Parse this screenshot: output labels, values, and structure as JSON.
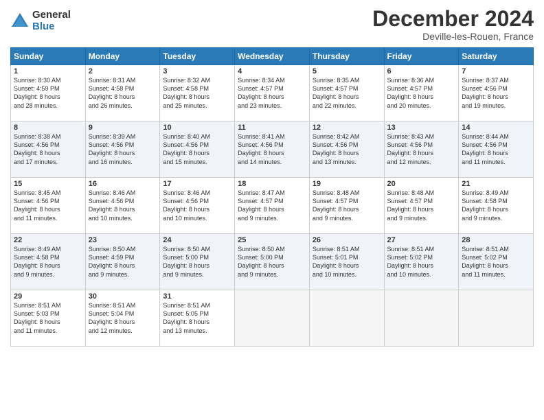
{
  "logo": {
    "general": "General",
    "blue": "Blue"
  },
  "header": {
    "month": "December 2024",
    "location": "Deville-les-Rouen, France"
  },
  "weekdays": [
    "Sunday",
    "Monday",
    "Tuesday",
    "Wednesday",
    "Thursday",
    "Friday",
    "Saturday"
  ],
  "weeks": [
    [
      {
        "day": 1,
        "info": "Sunrise: 8:30 AM\nSunset: 4:59 PM\nDaylight: 8 hours\nand 28 minutes."
      },
      {
        "day": 2,
        "info": "Sunrise: 8:31 AM\nSunset: 4:58 PM\nDaylight: 8 hours\nand 26 minutes."
      },
      {
        "day": 3,
        "info": "Sunrise: 8:32 AM\nSunset: 4:58 PM\nDaylight: 8 hours\nand 25 minutes."
      },
      {
        "day": 4,
        "info": "Sunrise: 8:34 AM\nSunset: 4:57 PM\nDaylight: 8 hours\nand 23 minutes."
      },
      {
        "day": 5,
        "info": "Sunrise: 8:35 AM\nSunset: 4:57 PM\nDaylight: 8 hours\nand 22 minutes."
      },
      {
        "day": 6,
        "info": "Sunrise: 8:36 AM\nSunset: 4:57 PM\nDaylight: 8 hours\nand 20 minutes."
      },
      {
        "day": 7,
        "info": "Sunrise: 8:37 AM\nSunset: 4:56 PM\nDaylight: 8 hours\nand 19 minutes."
      }
    ],
    [
      {
        "day": 8,
        "info": "Sunrise: 8:38 AM\nSunset: 4:56 PM\nDaylight: 8 hours\nand 17 minutes."
      },
      {
        "day": 9,
        "info": "Sunrise: 8:39 AM\nSunset: 4:56 PM\nDaylight: 8 hours\nand 16 minutes."
      },
      {
        "day": 10,
        "info": "Sunrise: 8:40 AM\nSunset: 4:56 PM\nDaylight: 8 hours\nand 15 minutes."
      },
      {
        "day": 11,
        "info": "Sunrise: 8:41 AM\nSunset: 4:56 PM\nDaylight: 8 hours\nand 14 minutes."
      },
      {
        "day": 12,
        "info": "Sunrise: 8:42 AM\nSunset: 4:56 PM\nDaylight: 8 hours\nand 13 minutes."
      },
      {
        "day": 13,
        "info": "Sunrise: 8:43 AM\nSunset: 4:56 PM\nDaylight: 8 hours\nand 12 minutes."
      },
      {
        "day": 14,
        "info": "Sunrise: 8:44 AM\nSunset: 4:56 PM\nDaylight: 8 hours\nand 11 minutes."
      }
    ],
    [
      {
        "day": 15,
        "info": "Sunrise: 8:45 AM\nSunset: 4:56 PM\nDaylight: 8 hours\nand 11 minutes."
      },
      {
        "day": 16,
        "info": "Sunrise: 8:46 AM\nSunset: 4:56 PM\nDaylight: 8 hours\nand 10 minutes."
      },
      {
        "day": 17,
        "info": "Sunrise: 8:46 AM\nSunset: 4:56 PM\nDaylight: 8 hours\nand 10 minutes."
      },
      {
        "day": 18,
        "info": "Sunrise: 8:47 AM\nSunset: 4:57 PM\nDaylight: 8 hours\nand 9 minutes."
      },
      {
        "day": 19,
        "info": "Sunrise: 8:48 AM\nSunset: 4:57 PM\nDaylight: 8 hours\nand 9 minutes."
      },
      {
        "day": 20,
        "info": "Sunrise: 8:48 AM\nSunset: 4:57 PM\nDaylight: 8 hours\nand 9 minutes."
      },
      {
        "day": 21,
        "info": "Sunrise: 8:49 AM\nSunset: 4:58 PM\nDaylight: 8 hours\nand 9 minutes."
      }
    ],
    [
      {
        "day": 22,
        "info": "Sunrise: 8:49 AM\nSunset: 4:58 PM\nDaylight: 8 hours\nand 9 minutes."
      },
      {
        "day": 23,
        "info": "Sunrise: 8:50 AM\nSunset: 4:59 PM\nDaylight: 8 hours\nand 9 minutes."
      },
      {
        "day": 24,
        "info": "Sunrise: 8:50 AM\nSunset: 5:00 PM\nDaylight: 8 hours\nand 9 minutes."
      },
      {
        "day": 25,
        "info": "Sunrise: 8:50 AM\nSunset: 5:00 PM\nDaylight: 8 hours\nand 9 minutes."
      },
      {
        "day": 26,
        "info": "Sunrise: 8:51 AM\nSunset: 5:01 PM\nDaylight: 8 hours\nand 10 minutes."
      },
      {
        "day": 27,
        "info": "Sunrise: 8:51 AM\nSunset: 5:02 PM\nDaylight: 8 hours\nand 10 minutes."
      },
      {
        "day": 28,
        "info": "Sunrise: 8:51 AM\nSunset: 5:02 PM\nDaylight: 8 hours\nand 11 minutes."
      }
    ],
    [
      {
        "day": 29,
        "info": "Sunrise: 8:51 AM\nSunset: 5:03 PM\nDaylight: 8 hours\nand 11 minutes."
      },
      {
        "day": 30,
        "info": "Sunrise: 8:51 AM\nSunset: 5:04 PM\nDaylight: 8 hours\nand 12 minutes."
      },
      {
        "day": 31,
        "info": "Sunrise: 8:51 AM\nSunset: 5:05 PM\nDaylight: 8 hours\nand 13 minutes."
      },
      null,
      null,
      null,
      null
    ]
  ]
}
